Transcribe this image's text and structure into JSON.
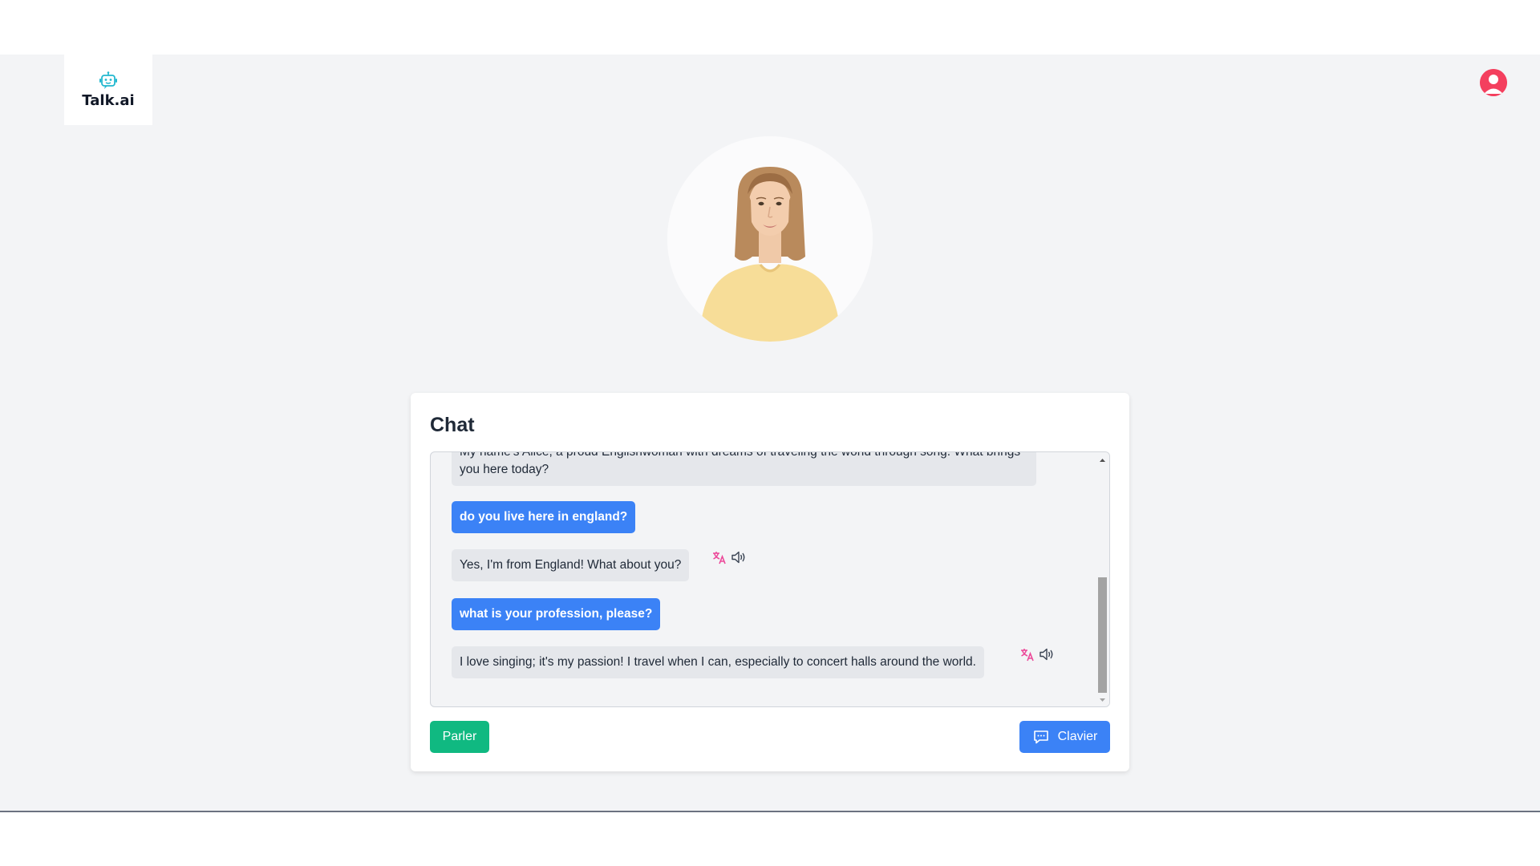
{
  "app": {
    "brand_name": "Talk.ai",
    "brand_color": "#22b8cf",
    "logo_icon": "robot-icon"
  },
  "header": {
    "user_avatar_icon": "user-avatar-icon",
    "avatar_color": "#f43f5e"
  },
  "character": {
    "portrait_icon": "character-portrait"
  },
  "chat": {
    "title": "Chat",
    "messages": [
      {
        "role": "bot",
        "text": "My name's Alice, a proud Englishwoman with dreams of traveling the world through song. What brings you here today?"
      },
      {
        "role": "user",
        "text": "do you live here in england?"
      },
      {
        "role": "bot",
        "text": "Yes, I'm from England! What about you?",
        "actions": [
          "translate-icon",
          "speaker-icon"
        ]
      },
      {
        "role": "user",
        "text": "what is your profession, please?"
      },
      {
        "role": "bot",
        "text": "I love singing; it's my passion! I travel when I can, especially to concert halls around the world.",
        "actions": [
          "translate-icon",
          "speaker-icon"
        ]
      }
    ],
    "colors": {
      "user_bubble": "#3b82f6",
      "bot_bubble": "#e5e7eb",
      "translate_icon": "#ec4899"
    }
  },
  "controls": {
    "speak_label": "Parler",
    "speak_color": "#10b981",
    "keyboard_label": "Clavier",
    "keyboard_icon": "chat-bubble-icon",
    "keyboard_color": "#3b82f6"
  }
}
